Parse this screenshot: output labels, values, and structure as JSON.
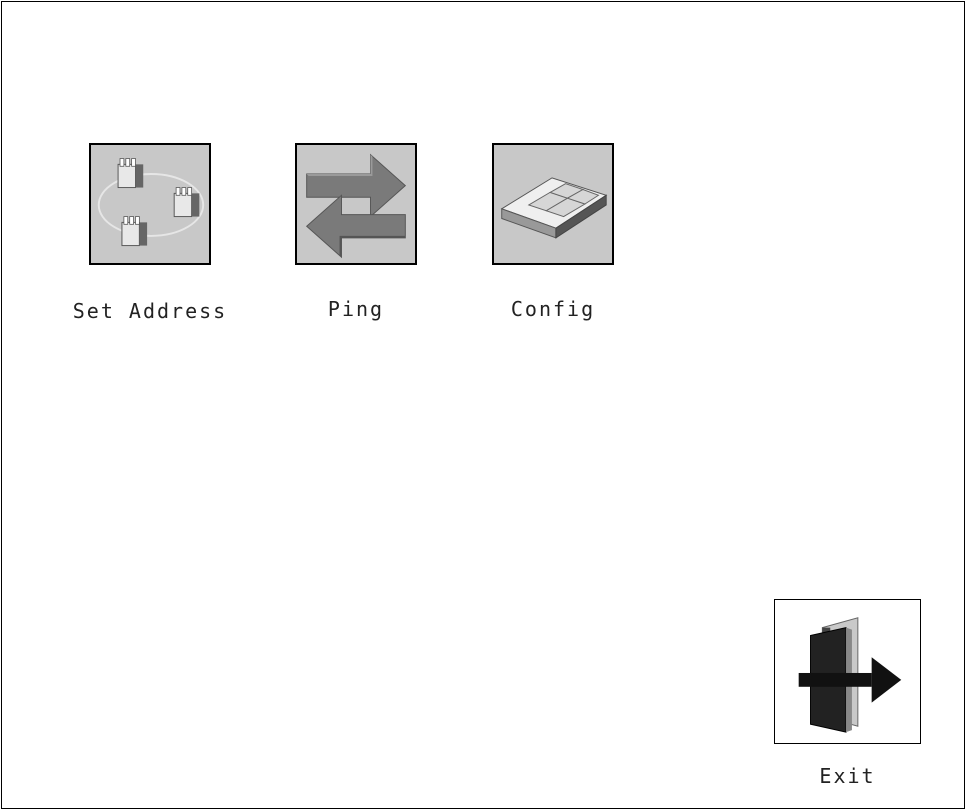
{
  "launcher": {
    "items": [
      {
        "label": "Set Address",
        "icon": "network-nodes-icon"
      },
      {
        "label": "Ping",
        "icon": "ping-arrows-icon"
      },
      {
        "label": "Config",
        "icon": "config-panel-icon"
      }
    ],
    "exit": {
      "label": "Exit",
      "icon": "exit-door-icon"
    }
  },
  "colors": {
    "tile_bg": "#c8c8c8",
    "arrow": "#7a7a7a",
    "frame": "#000000"
  }
}
